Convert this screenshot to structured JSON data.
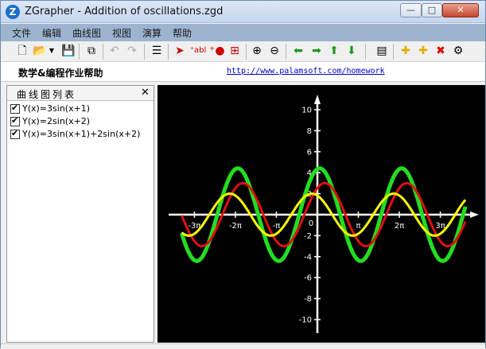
{
  "window": {
    "title": "ZGrapher - Addition of oscillations.zgd",
    "app_icon": "Z"
  },
  "controls": {
    "minimize": "—",
    "maximize": "□",
    "close": "✕"
  },
  "menu": [
    "文件",
    "编辑",
    "曲线图",
    "视图",
    "演算",
    "帮助"
  ],
  "toolbar": {
    "icons": [
      "new-file-icon",
      "open-folder-icon",
      "dropdown-arrow-icon",
      "save-icon",
      "copy-icon",
      "undo-icon",
      "redo-icon",
      "list-icon",
      "pointer-icon",
      "text-label-icon",
      "point-icon",
      "zoom-area-icon",
      "zoom-in-icon",
      "zoom-out-icon",
      "arrow-left-icon",
      "arrow-right-icon",
      "arrow-up-icon",
      "arrow-down-icon",
      "table-icon",
      "add-curve-icon",
      "add-curve-alt-icon",
      "delete-icon",
      "properties-icon"
    ]
  },
  "info": {
    "title": "数学&编程作业帮助",
    "link": "http://www.palamsoft.com/homework"
  },
  "panel": {
    "title": "曲线图列表",
    "close": "✕",
    "curves": [
      "Y(x)=3sin(x+1)",
      "Y(x)=2sin(x+2)",
      "Y(x)=3sin(x+1)+2sin(x+2)"
    ]
  },
  "colors": {
    "graph_bg": "#000000",
    "axis": "#ffffff",
    "curve1": "#e01010",
    "curve2": "#ffff00",
    "curve3": "#22dd22"
  },
  "chart_data": {
    "type": "line",
    "x_ticks": [
      "-3π",
      "-2π",
      "-π",
      "π",
      "2π",
      "3π"
    ],
    "y_ticks": [
      "10",
      "8",
      "6",
      "4",
      "2",
      "-2",
      "-4",
      "-6",
      "-8",
      "-10"
    ],
    "origin_label": "0",
    "xlim": [
      -10.4,
      11.4
    ],
    "ylim": [
      -11,
      11
    ],
    "series": [
      {
        "name": "Y(x)=3sin(x+1)",
        "a": 3,
        "phase": 1
      },
      {
        "name": "Y(x)=2sin(x+2)",
        "a": 2,
        "phase": 2
      },
      {
        "name": "Y(x)=3sin(x+1)+2sin(x+2)",
        "sum": true
      }
    ]
  }
}
